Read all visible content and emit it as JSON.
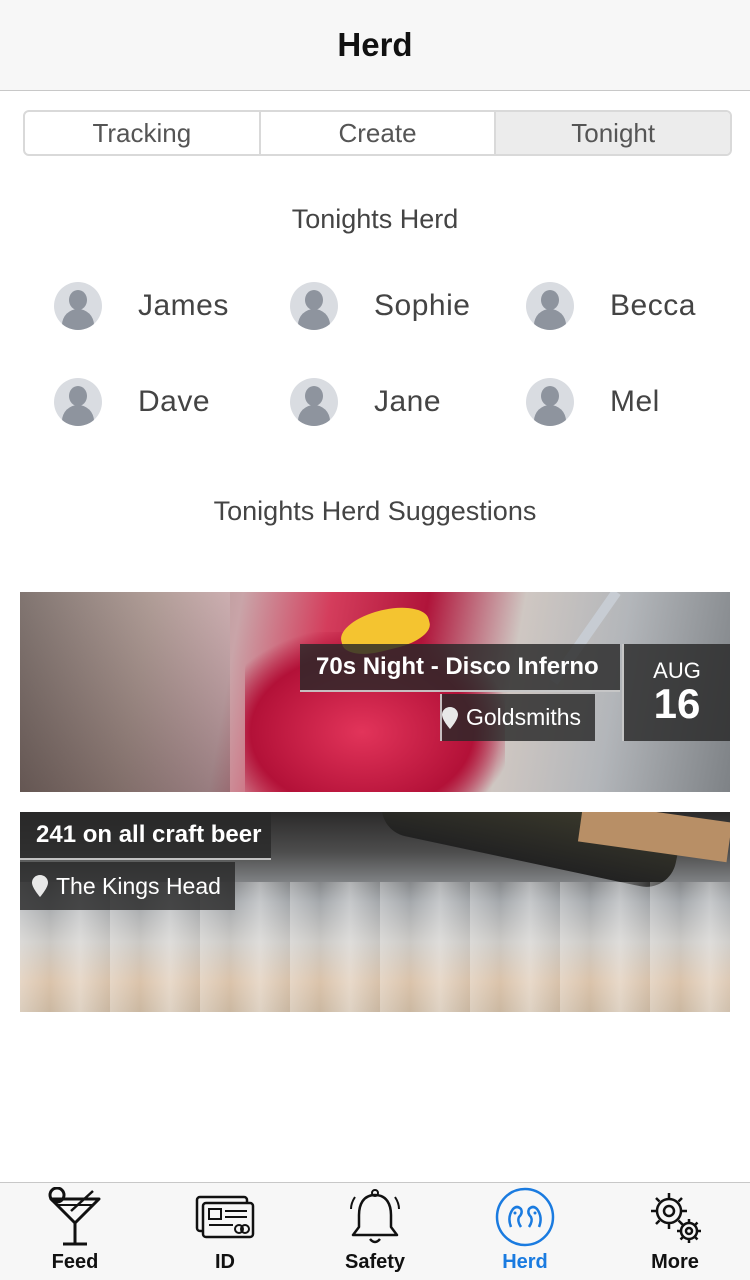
{
  "navbar": {
    "title": "Herd"
  },
  "segments": [
    {
      "label": "Tracking",
      "active": false
    },
    {
      "label": "Create",
      "active": false
    },
    {
      "label": "Tonight",
      "active": true
    }
  ],
  "tonights_herd": {
    "title": "Tonights Herd",
    "friends": [
      "James",
      "Sophie",
      "Becca",
      "Dave",
      "Jane",
      "Mel"
    ]
  },
  "suggestions": {
    "title": "Tonights Herd Suggestions",
    "events": [
      {
        "title": "70s Night - Disco Inferno",
        "venue": "Goldsmiths",
        "date_month": "AUG",
        "date_day": "16"
      },
      {
        "title": "241 on all craft beer",
        "venue": "The Kings Head"
      }
    ]
  },
  "tabbar": {
    "active_color": "#1a7be0",
    "tabs": [
      {
        "label": "Feed",
        "icon": "cocktail-icon"
      },
      {
        "label": "ID",
        "icon": "id-card-icon"
      },
      {
        "label": "Safety",
        "icon": "bell-icon"
      },
      {
        "label": "Herd",
        "icon": "herd-icon",
        "active": true
      },
      {
        "label": "More",
        "icon": "gears-icon"
      }
    ]
  }
}
